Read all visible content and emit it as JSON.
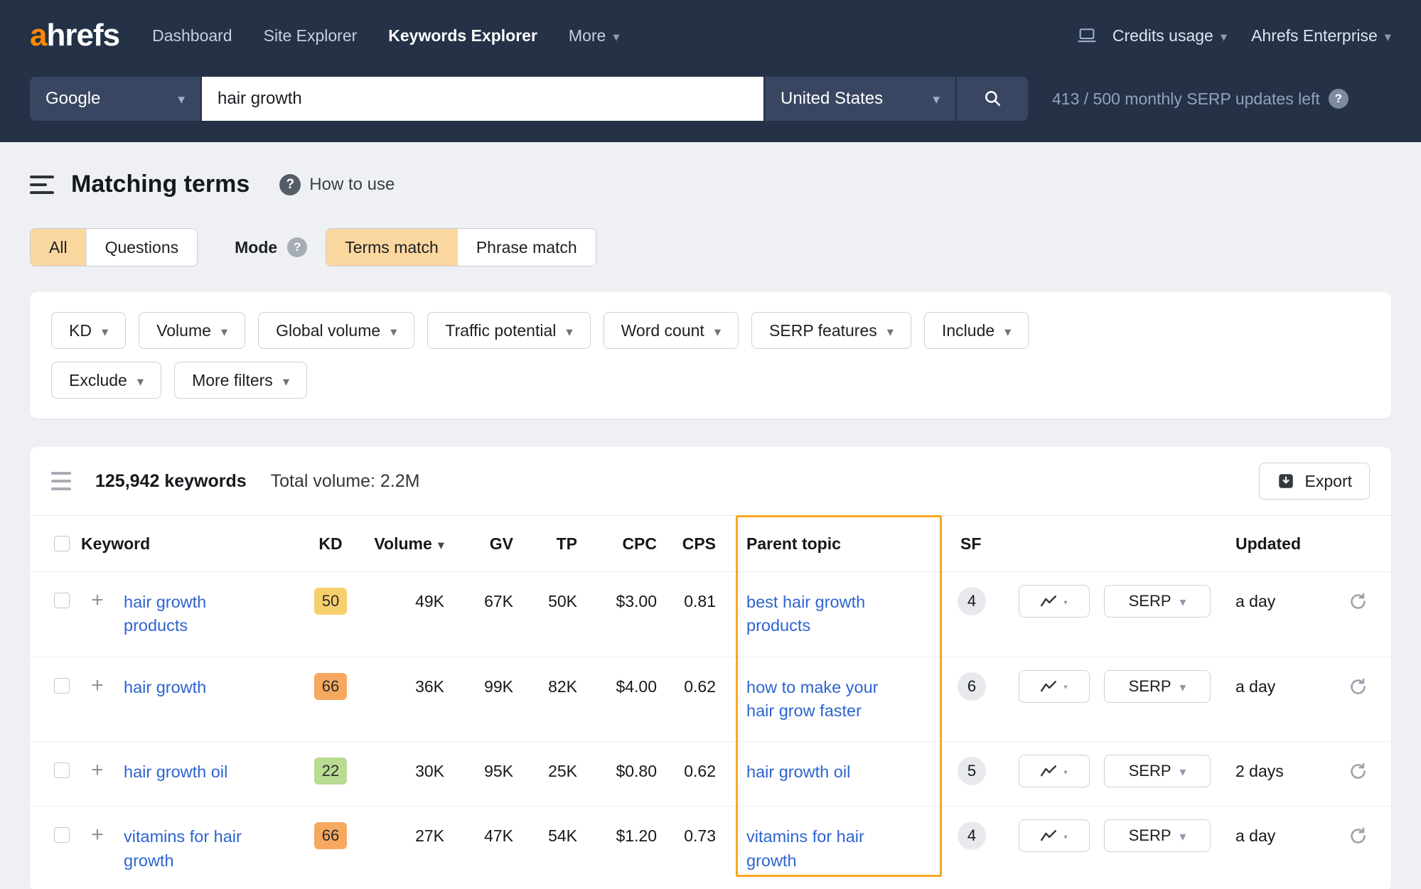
{
  "colors": {
    "brand_orange": "#ff8a00",
    "highlight_orange": "#f6a723",
    "link_blue": "#2d64d0",
    "kd_yellow": "#f8cf6d",
    "kd_orange": "#f6a860",
    "kd_green": "#b9db92",
    "navbar_bg": "#243146",
    "active_tab_bg": "#fbd7a0"
  },
  "navbar": {
    "logo": {
      "accent": "a",
      "rest": "hrefs"
    },
    "items": [
      {
        "label": "Dashboard",
        "active": false,
        "caret": false
      },
      {
        "label": "Site Explorer",
        "active": false,
        "caret": false
      },
      {
        "label": "Keywords Explorer",
        "active": true,
        "caret": false
      },
      {
        "label": "More",
        "active": false,
        "caret": true
      }
    ],
    "credits_label": "Credits usage",
    "enterprise_label": "Ahrefs Enterprise"
  },
  "searchbar": {
    "engine": "Google",
    "query": "hair growth",
    "country": "United States",
    "quota": "413 / 500 monthly SERP updates left"
  },
  "header": {
    "title": "Matching terms",
    "help_label": "How to use"
  },
  "tabs": {
    "all": "All",
    "questions": "Questions",
    "mode_label": "Mode",
    "terms_match": "Terms match",
    "phrase_match": "Phrase match"
  },
  "filters": [
    [
      "KD",
      "Volume",
      "Global volume",
      "Traffic potential",
      "Word count",
      "SERP features",
      "Include"
    ],
    [
      "Exclude",
      "More filters"
    ]
  ],
  "results": {
    "count": "125,942 keywords",
    "total_volume": "Total volume: 2.2M",
    "export_label": "Export",
    "serp_label": "SERP",
    "columns": {
      "keyword": "Keyword",
      "kd": "KD",
      "volume": "Volume",
      "gv": "GV",
      "tp": "TP",
      "cpc": "CPC",
      "cps": "CPS",
      "parent_topic": "Parent topic",
      "sf": "SF",
      "updated": "Updated"
    },
    "rows": [
      {
        "keyword": "hair growth products",
        "kd": "50",
        "kd_color": "yellow",
        "volume": "49K",
        "gv": "67K",
        "tp": "50K",
        "cpc": "$3.00",
        "cps": "0.81",
        "parent_topic": "best hair growth products",
        "sf": "4",
        "updated": "a day"
      },
      {
        "keyword": "hair growth",
        "kd": "66",
        "kd_color": "orange",
        "volume": "36K",
        "gv": "99K",
        "tp": "82K",
        "cpc": "$4.00",
        "cps": "0.62",
        "parent_topic": "how to make your hair grow faster",
        "sf": "6",
        "updated": "a day"
      },
      {
        "keyword": "hair growth oil",
        "kd": "22",
        "kd_color": "green",
        "volume": "30K",
        "gv": "95K",
        "tp": "25K",
        "cpc": "$0.80",
        "cps": "0.62",
        "parent_topic": "hair growth oil",
        "sf": "5",
        "updated": "2 days"
      },
      {
        "keyword": "vitamins for hair growth",
        "kd": "66",
        "kd_color": "orange",
        "volume": "27K",
        "gv": "47K",
        "tp": "54K",
        "cpc": "$1.20",
        "cps": "0.73",
        "parent_topic": "vitamins for hair growth",
        "sf": "4",
        "updated": "a day"
      }
    ]
  }
}
